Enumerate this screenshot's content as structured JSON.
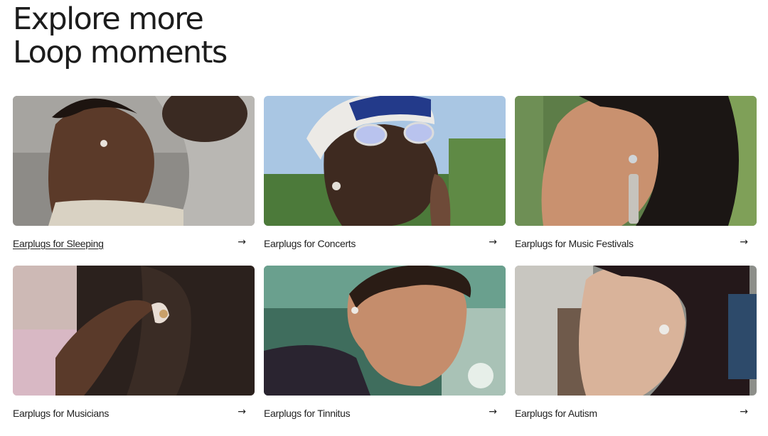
{
  "heading": {
    "line1": "Explore more",
    "line2": "Loop moments"
  },
  "arrow_glyph": "→",
  "cards": [
    {
      "label": "Earplugs for Sleeping",
      "underlined": true,
      "image": "couple-sleeping-photo"
    },
    {
      "label": "Earplugs for Concerts",
      "underlined": false,
      "image": "man-cap-glasses-photo"
    },
    {
      "label": "Earplugs for Music Festivals",
      "underlined": false,
      "image": "woman-braid-earring-photo"
    },
    {
      "label": "Earplugs for Musicians",
      "underlined": false,
      "image": "hand-inserting-earplug-photo"
    },
    {
      "label": "Earplugs for Tinnitus",
      "underlined": false,
      "image": "young-man-looking-down-photo"
    },
    {
      "label": "Earplugs for Autism",
      "underlined": false,
      "image": "woman-side-profile-photo"
    }
  ]
}
